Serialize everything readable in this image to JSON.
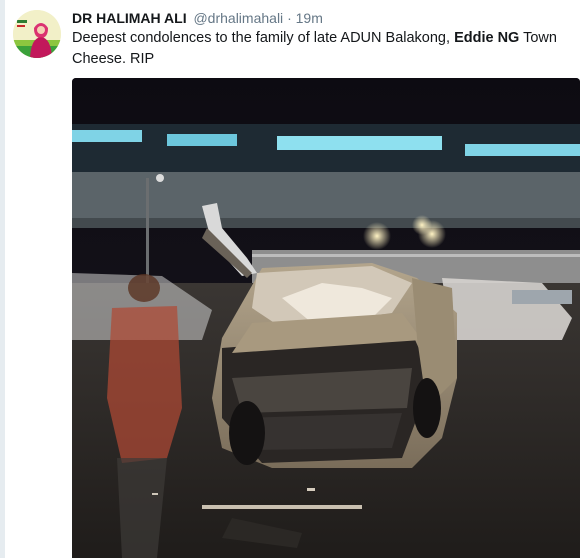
{
  "tweet": {
    "display_name": "DR HALIMAH ALI",
    "handle": "@drhalimahali",
    "separator": "·",
    "time": "19m",
    "text_before": "Deepest condolences to the family of late ADUN Balakong, ",
    "text_bold": "Eddie NG",
    "text_after": " Town Cheese. RIP"
  },
  "colors": {
    "text_primary": "#14171a",
    "text_secondary": "#657786",
    "background": "#ffffff"
  },
  "icons": {
    "avatar": "profile-photo"
  }
}
